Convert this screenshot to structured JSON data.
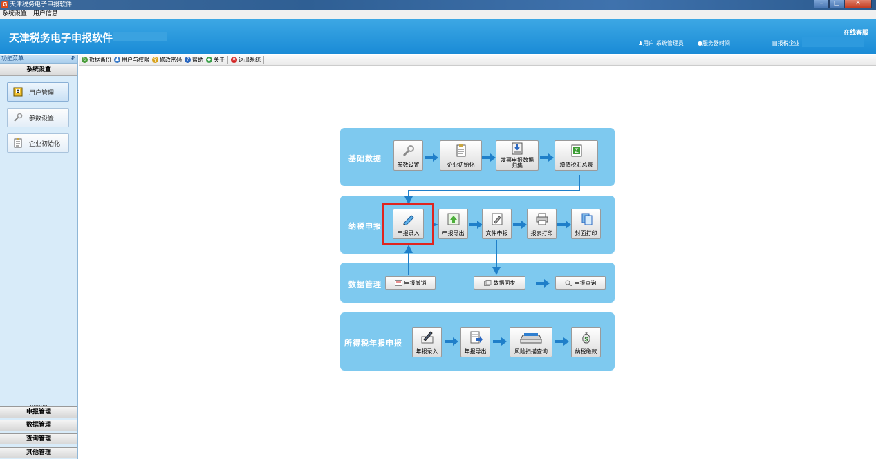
{
  "window": {
    "title": "天津税务电子申报软件",
    "controls": [
      "–",
      "□",
      "✕"
    ]
  },
  "menu": {
    "items": [
      "系统设置",
      "用户信息"
    ]
  },
  "header": {
    "app_name": "天津税务电子申报软件",
    "online_service": "在线客服",
    "user_label": "用户:系统管理员",
    "server_time_label": "服务器时间",
    "enterprise_label": "报税企业"
  },
  "sidebar": {
    "panel_title": "功能菜单",
    "pin": "₽",
    "active_group": "系统设置",
    "items": [
      {
        "label": "用户管理",
        "icon": "user-card-icon"
      },
      {
        "label": "参数设置",
        "icon": "wrench-icon"
      },
      {
        "label": "企业初始化",
        "icon": "clipboard-icon"
      }
    ],
    "collapsed_marker": "..........",
    "groups": [
      "申报管理",
      "数据管理",
      "查询管理",
      "其他管理"
    ]
  },
  "toolbar": {
    "items": [
      {
        "label": "数据备份",
        "icon": "backup-icon",
        "color": "#4a9d3a"
      },
      {
        "label": "用户与权限",
        "icon": "users-icon",
        "color": "#3b7bc8"
      },
      {
        "label": "修改密码",
        "icon": "key-icon",
        "color": "#d8a21b"
      },
      {
        "label": "帮助",
        "icon": "help-icon",
        "color": "#2a67c0"
      },
      {
        "label": "关于",
        "icon": "tag-icon",
        "color": "#3aa04a"
      },
      {
        "label": "退出系统",
        "icon": "close-icon",
        "color": "#d22323"
      }
    ]
  },
  "flow": {
    "basic": {
      "label": "基础数据",
      "buttons": [
        "参数设置",
        "企业初始化",
        "发票申报数据\n归集",
        "增值税汇总表"
      ]
    },
    "tax": {
      "label": "纳税申报",
      "buttons": [
        "申报录入",
        "申报导出",
        "文件申报",
        "报表打印",
        "封面打印"
      ]
    },
    "data": {
      "label": "数据管理",
      "buttons": [
        "申报撤销",
        "数据同步",
        "申报查询"
      ]
    },
    "income": {
      "label": "所得税年报申报",
      "buttons": [
        "年报录入",
        "年报导出",
        "风险扫描查询",
        "纳税缴款"
      ]
    }
  },
  "colors": {
    "panel": "#7ec9ef",
    "arrow": "#1f7fc9",
    "header": "#1a8bd6",
    "highlight": "#e0251f"
  }
}
